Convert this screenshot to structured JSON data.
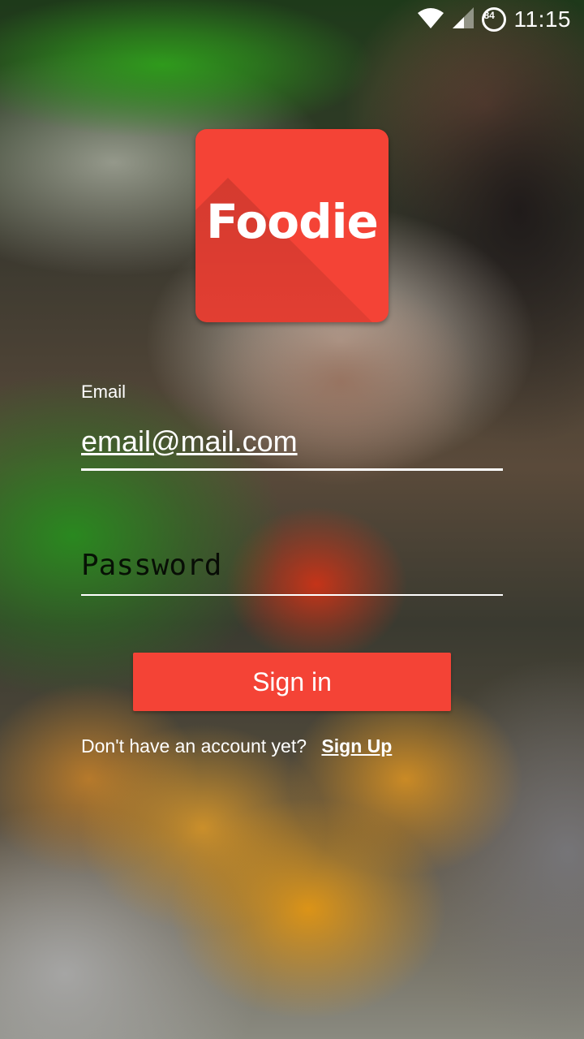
{
  "status_bar": {
    "battery_level": "84",
    "time": "11:15"
  },
  "logo": {
    "text": "Foodie",
    "color": "#f44336"
  },
  "login_form": {
    "email_label": "Email",
    "email_value": "email@mail.com",
    "password_placeholder": "Password",
    "signin_label": "Sign in",
    "signup_prompt": "Don't have an account yet?",
    "signup_link": "Sign Up"
  },
  "icons": {
    "wifi": "wifi-icon",
    "signal": "cell-signal-icon",
    "battery": "battery-icon"
  },
  "colors": {
    "accent": "#f44336"
  }
}
